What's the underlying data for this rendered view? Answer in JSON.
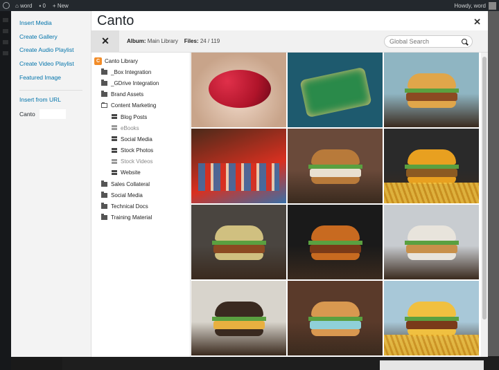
{
  "adminbar": {
    "site_name": "word",
    "comments_count": "0",
    "new_label": "New",
    "howdy": "Howdy, word"
  },
  "menu": {
    "items": [
      "Insert Media",
      "Create Gallery",
      "Create Audio Playlist",
      "Create Video Playlist",
      "Featured Image"
    ],
    "insert_url": "Insert from URL",
    "active": "Canto"
  },
  "frame": {
    "title": "Canto",
    "close_icon": "close-icon"
  },
  "toolbar": {
    "album_label": "Album:",
    "album_value": "Main Library",
    "files_label": "Files:",
    "files_value": "24 / 119",
    "search_placeholder": "Global Search"
  },
  "tree": {
    "root": "Canto Library",
    "nodes": [
      {
        "label": "_Box Integration",
        "level": 1,
        "icon": "folder"
      },
      {
        "label": "_GDrive Integration",
        "level": 1,
        "icon": "folder"
      },
      {
        "label": "Brand Assets",
        "level": 1,
        "icon": "folder"
      },
      {
        "label": "Content Marketing",
        "level": 1,
        "icon": "folder-open"
      },
      {
        "label": "Blog Posts",
        "level": 2,
        "icon": "album"
      },
      {
        "label": "eBooks",
        "level": 2,
        "icon": "album",
        "dim": true
      },
      {
        "label": "Social Media",
        "level": 2,
        "icon": "album"
      },
      {
        "label": "Stock Photos",
        "level": 2,
        "icon": "album"
      },
      {
        "label": "Stock Videos",
        "level": 2,
        "icon": "album",
        "dim": true
      },
      {
        "label": "Website",
        "level": 2,
        "icon": "album"
      },
      {
        "label": "Sales Collateral",
        "level": 1,
        "icon": "folder"
      },
      {
        "label": "Social Media",
        "level": 1,
        "icon": "folder"
      },
      {
        "label": "Technical Docs",
        "level": 1,
        "icon": "folder"
      },
      {
        "label": "Training Material",
        "level": 1,
        "icon": "folder"
      }
    ]
  },
  "grid": {
    "tiles": [
      {
        "subject": "strawberries",
        "colors": [
          "#c8a48a",
          "#b0142a",
          "#f0d8c8"
        ]
      },
      {
        "subject": "food-platter",
        "colors": [
          "#1e5a6e",
          "#e2c27a",
          "#2a8a4a"
        ]
      },
      {
        "subject": "burger",
        "colors": [
          "#8fb5c2",
          "#8b4a22",
          "#e0a64a"
        ]
      },
      {
        "subject": "market-food",
        "colors": [
          "#4a2a1a",
          "#d93020",
          "#3a70a8"
        ]
      },
      {
        "subject": "burger-plate",
        "colors": [
          "#6a4a3a",
          "#e8e0d0",
          "#b87a3a"
        ]
      },
      {
        "subject": "burger-fries",
        "colors": [
          "#2a2a2a",
          "#8b5a22",
          "#e8a020"
        ]
      },
      {
        "subject": "burger-dark",
        "colors": [
          "#4a4540",
          "#8b4a22",
          "#d0c080"
        ]
      },
      {
        "subject": "burger-beer",
        "colors": [
          "#1a1a1a",
          "#7a3a18",
          "#c86a20"
        ]
      },
      {
        "subject": "two-burgers",
        "colors": [
          "#c8ccd0",
          "#c8904a",
          "#e8e4dc"
        ]
      },
      {
        "subject": "fancy-burger",
        "colors": [
          "#d8d4cc",
          "#e8b040",
          "#3a2a20"
        ]
      },
      {
        "subject": "bun-plate",
        "colors": [
          "#5a3a2a",
          "#8fd0d8",
          "#d89850"
        ]
      },
      {
        "subject": "burger-fries-2",
        "colors": [
          "#a8c8d8",
          "#7a3a1a",
          "#f0c040"
        ]
      }
    ]
  }
}
